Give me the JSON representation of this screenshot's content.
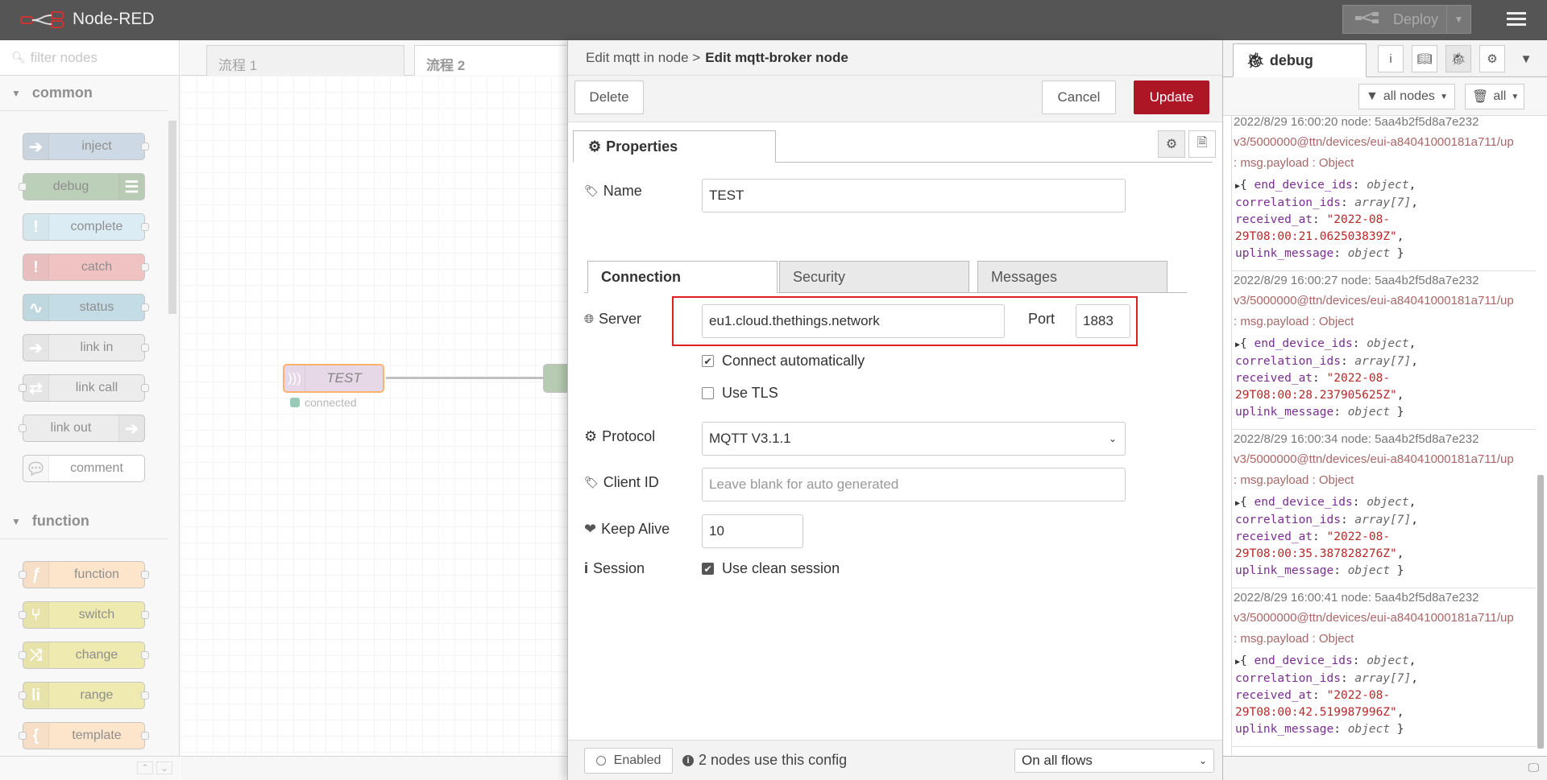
{
  "app": {
    "title": "Node-RED"
  },
  "header": {
    "deploy_label": "Deploy"
  },
  "palette": {
    "search_placeholder": "filter nodes",
    "categories": [
      {
        "label": "common"
      },
      {
        "label": "function"
      }
    ],
    "nodes": [
      {
        "label": "inject",
        "color": "#a6bbcf"
      },
      {
        "label": "debug",
        "color": "#87a980"
      },
      {
        "label": "complete",
        "color": "#c0deed"
      },
      {
        "label": "catch",
        "color": "#e2d96e"
      },
      {
        "label": "status",
        "color": "#94c1d0"
      },
      {
        "label": "link in",
        "color": "#dddddd"
      },
      {
        "label": "link call",
        "color": "#dddddd"
      },
      {
        "label": "link out",
        "color": "#dddddd"
      },
      {
        "label": "comment",
        "color": "#ffffff"
      },
      {
        "label": "function",
        "color": "#fdd0a2"
      },
      {
        "label": "switch",
        "color": "#e2d96e"
      },
      {
        "label": "change",
        "color": "#e2d96e"
      },
      {
        "label": "range",
        "color": "#e2d96e"
      },
      {
        "label": "template",
        "color": "#fdd0a2"
      }
    ]
  },
  "workspace": {
    "tabs": [
      {
        "label": "流程 1"
      },
      {
        "label": "流程 2"
      }
    ],
    "node": {
      "label": "TEST",
      "status": "connected"
    }
  },
  "tray": {
    "breadcrumb_prefix": "Edit mqtt in node >",
    "title": "Edit mqtt-broker node",
    "delete_label": "Delete",
    "cancel_label": "Cancel",
    "update_label": "Update",
    "properties_tab": "Properties",
    "name_label": "Name",
    "name_value": "TEST",
    "tabs": [
      {
        "label": "Connection"
      },
      {
        "label": "Security"
      },
      {
        "label": "Messages"
      }
    ],
    "server_label": "Server",
    "server_value": "eu1.cloud.thethings.network",
    "port_label": "Port",
    "port_value": "1883",
    "connect_auto_label": "Connect automatically",
    "use_tls_label": "Use TLS",
    "protocol_label": "Protocol",
    "protocol_value": "MQTT V3.1.1",
    "client_id_label": "Client ID",
    "client_id_placeholder": "Leave blank for auto generated",
    "keep_alive_label": "Keep Alive",
    "keep_alive_value": "10",
    "session_label": "Session",
    "clean_session_label": "Use clean session",
    "enabled_label": "Enabled",
    "nodes_use_config": "2 nodes use this config",
    "scope_value": "On all flows"
  },
  "sidebar": {
    "tab_label": "debug",
    "filter_nodes": "all nodes",
    "filter_all": "all",
    "messages": [
      {
        "meta": "2022/8/29 16:00:20   node: 5aa4b2f5d8a7e232",
        "topic": "v3/5000000@ttn/devices/eui-a84041000181a711/up",
        "payload": ": msg.payload : Object",
        "received_at": "\"2022-08-29T08:00:21.062503839Z\""
      },
      {
        "meta": "2022/8/29 16:00:27   node: 5aa4b2f5d8a7e232",
        "topic": "v3/5000000@ttn/devices/eui-a84041000181a711/up",
        "payload": ": msg.payload : Object",
        "received_at": "\"2022-08-29T08:00:28.237905625Z\""
      },
      {
        "meta": "2022/8/29 16:00:34   node: 5aa4b2f5d8a7e232",
        "topic": "v3/5000000@ttn/devices/eui-a84041000181a711/up",
        "payload": ": msg.payload : Object",
        "received_at": "\"2022-08-29T08:00:35.387828276Z\""
      },
      {
        "meta": "2022/8/29 16:00:41   node: 5aa4b2f5d8a7e232",
        "topic": "v3/5000000@ttn/devices/eui-a84041000181a711/up",
        "payload": ": msg.payload : Object",
        "received_at": "\"2022-08-29T08:00:42.519987996Z\""
      }
    ],
    "obj_keys": {
      "end_device_ids": "end_device_ids",
      "correlation_ids": "correlation_ids",
      "received_at": "received_at",
      "uplink_message": "uplink_message",
      "type_object": "object",
      "type_array": "array[7]"
    }
  }
}
